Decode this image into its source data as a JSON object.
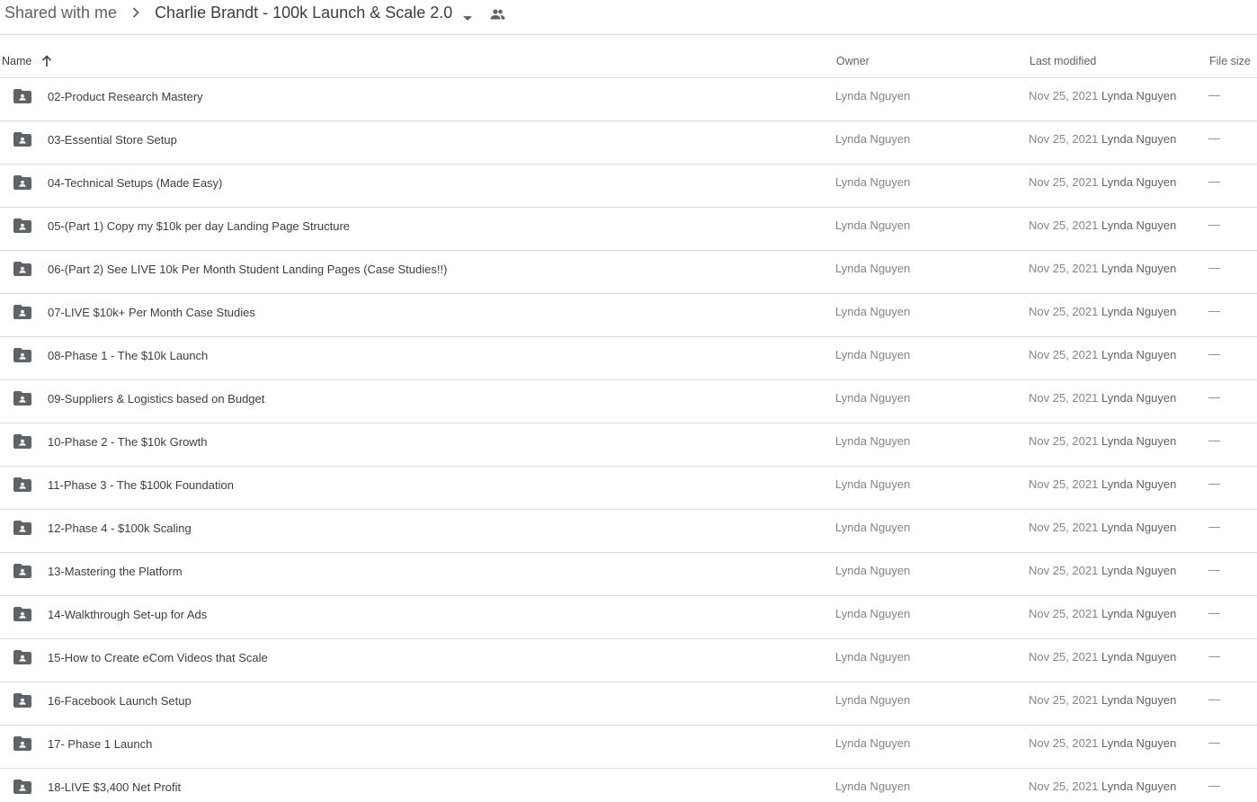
{
  "breadcrumb": {
    "root": "Shared with me",
    "current": "Charlie Brandt - 100k Launch & Scale 2.0"
  },
  "columns": {
    "name": "Name",
    "owner": "Owner",
    "last_modified": "Last modified",
    "file_size": "File size"
  },
  "files": [
    {
      "name": "02-Product Research Mastery",
      "owner": "Lynda Nguyen",
      "modified": "Nov 25, 2021",
      "modified_by": "Lynda Nguyen",
      "size": "—"
    },
    {
      "name": "03-Essential Store Setup",
      "owner": "Lynda Nguyen",
      "modified": "Nov 25, 2021",
      "modified_by": "Lynda Nguyen",
      "size": "—"
    },
    {
      "name": "04-Technical Setups (Made Easy)",
      "owner": "Lynda Nguyen",
      "modified": "Nov 25, 2021",
      "modified_by": "Lynda Nguyen",
      "size": "—"
    },
    {
      "name": "05-(Part 1) Copy my $10k per day Landing Page Structure",
      "owner": "Lynda Nguyen",
      "modified": "Nov 25, 2021",
      "modified_by": "Lynda Nguyen",
      "size": "—"
    },
    {
      "name": "06-(Part 2) See LIVE 10k Per Month Student Landing Pages (Case Studies!!)",
      "owner": "Lynda Nguyen",
      "modified": "Nov 25, 2021",
      "modified_by": "Lynda Nguyen",
      "size": "—"
    },
    {
      "name": "07-LIVE $10k+ Per Month Case Studies",
      "owner": "Lynda Nguyen",
      "modified": "Nov 25, 2021",
      "modified_by": "Lynda Nguyen",
      "size": "—"
    },
    {
      "name": "08-Phase 1 - The $10k Launch",
      "owner": "Lynda Nguyen",
      "modified": "Nov 25, 2021",
      "modified_by": "Lynda Nguyen",
      "size": "—"
    },
    {
      "name": "09-Suppliers & Logistics based on Budget",
      "owner": "Lynda Nguyen",
      "modified": "Nov 25, 2021",
      "modified_by": "Lynda Nguyen",
      "size": "—"
    },
    {
      "name": "10-Phase 2 - The $10k Growth",
      "owner": "Lynda Nguyen",
      "modified": "Nov 25, 2021",
      "modified_by": "Lynda Nguyen",
      "size": "—"
    },
    {
      "name": "11-Phase 3 - The $100k Foundation",
      "owner": "Lynda Nguyen",
      "modified": "Nov 25, 2021",
      "modified_by": "Lynda Nguyen",
      "size": "—"
    },
    {
      "name": "12-Phase 4 - $100k Scaling",
      "owner": "Lynda Nguyen",
      "modified": "Nov 25, 2021",
      "modified_by": "Lynda Nguyen",
      "size": "—"
    },
    {
      "name": "13-Mastering the Platform",
      "owner": "Lynda Nguyen",
      "modified": "Nov 25, 2021",
      "modified_by": "Lynda Nguyen",
      "size": "—"
    },
    {
      "name": "14-Walkthrough Set-up for Ads",
      "owner": "Lynda Nguyen",
      "modified": "Nov 25, 2021",
      "modified_by": "Lynda Nguyen",
      "size": "—"
    },
    {
      "name": "15-How to Create eCom Videos that Scale",
      "owner": "Lynda Nguyen",
      "modified": "Nov 25, 2021",
      "modified_by": "Lynda Nguyen",
      "size": "—"
    },
    {
      "name": "16-Facebook Launch Setup",
      "owner": "Lynda Nguyen",
      "modified": "Nov 25, 2021",
      "modified_by": "Lynda Nguyen",
      "size": "—"
    },
    {
      "name": "17- Phase 1 Launch",
      "owner": "Lynda Nguyen",
      "modified": "Nov 25, 2021",
      "modified_by": "Lynda Nguyen",
      "size": "—"
    },
    {
      "name": "18-LIVE $3,400 Net Profit",
      "owner": "Lynda Nguyen",
      "modified": "Nov 25, 2021",
      "modified_by": "Lynda Nguyen",
      "size": "—"
    }
  ],
  "icons": {
    "folder": "shared-folder-icon",
    "sort": "arrow-up-icon",
    "breadcrumb_separator": "chevron-right-icon",
    "dropdown": "caret-down-icon",
    "shared": "people-icon"
  },
  "colors": {
    "folder_icon": "#5f6368",
    "divider": "#dadce0",
    "muted_text": "#80868b"
  }
}
